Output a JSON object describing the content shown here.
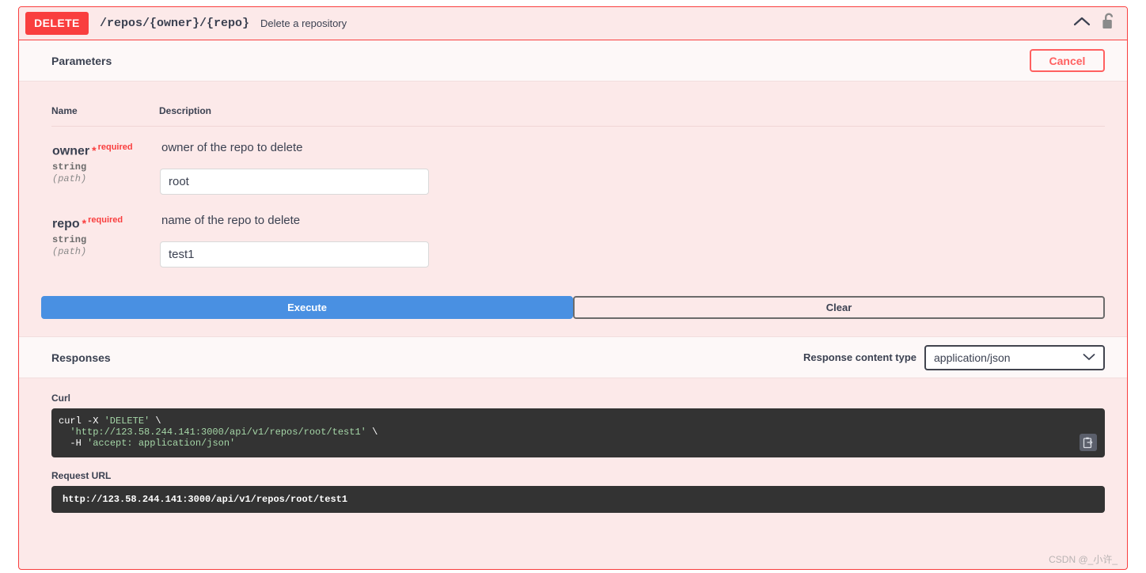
{
  "operation": {
    "method": "DELETE",
    "path": "/repos/{owner}/{repo}",
    "summary": "Delete a repository",
    "collapse_icon": "chevron-up-icon",
    "auth_icon": "unlocked-padlock-icon"
  },
  "parameters_section": {
    "title": "Parameters",
    "cancel_label": "Cancel",
    "columns": {
      "name": "Name",
      "description": "Description"
    },
    "rows": [
      {
        "name": "owner",
        "required_mark": "*",
        "required_label": "required",
        "type": "string",
        "in": "(path)",
        "description": "owner of the repo to delete",
        "value": "root",
        "placeholder": "owner"
      },
      {
        "name": "repo",
        "required_mark": "*",
        "required_label": "required",
        "type": "string",
        "in": "(path)",
        "description": "name of the repo to delete",
        "value": "test1",
        "placeholder": "repo"
      }
    ]
  },
  "actions": {
    "execute_label": "Execute",
    "clear_label": "Clear"
  },
  "responses_section": {
    "title": "Responses",
    "content_type_label": "Response content type",
    "content_type_value": "application/json",
    "content_type_options": [
      "application/json"
    ],
    "dropdown_icon": "chevron-down-icon"
  },
  "curl": {
    "label": "Curl",
    "line1_plain": "curl -X ",
    "line1_str": "'DELETE'",
    "line1_tail": " \\",
    "line2_str": "  'http://123.58.244.141:3000/api/v1/repos/root/test1'",
    "line2_tail": " \\",
    "line3_plain": "  -H ",
    "line3_str": "'accept: application/json'",
    "copy_icon": "copy-to-clipboard-icon"
  },
  "request_url": {
    "label": "Request URL",
    "value": "http://123.58.244.141:3000/api/v1/repos/root/test1"
  },
  "watermark": {
    "text": "CSDN @_小许_"
  },
  "colors": {
    "method_red": "#f93e3e",
    "block_bg": "#fce9e9",
    "execute_blue": "#4990e2",
    "code_bg": "#333333",
    "code_string_green": "#a5d6a7"
  }
}
